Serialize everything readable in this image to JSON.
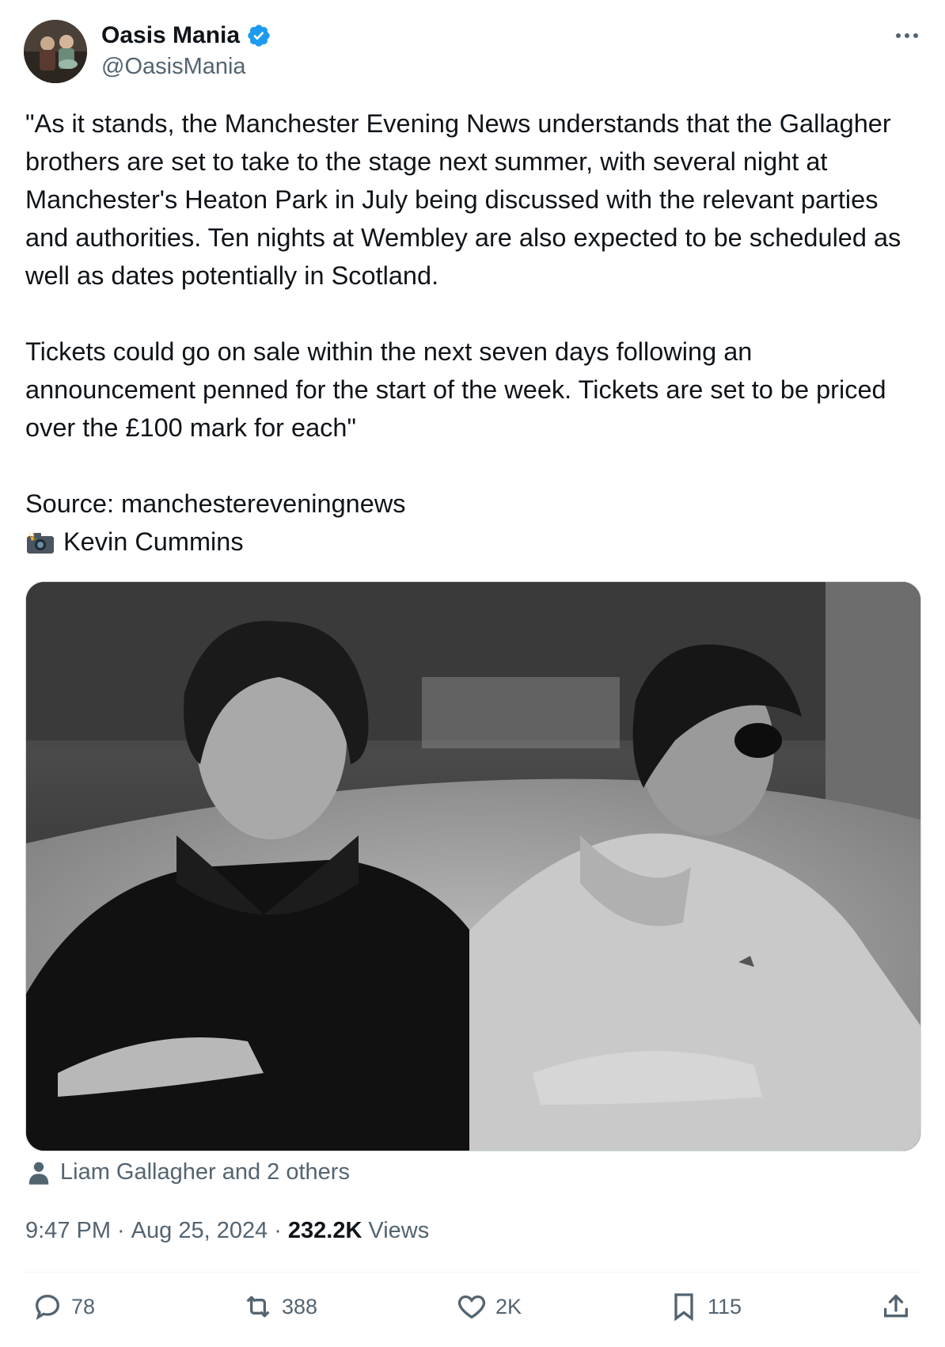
{
  "author": {
    "name": "Oasis Mania",
    "handle": "@OasisMania",
    "verified": true,
    "verified_color": "#1d9bf0"
  },
  "tweet": {
    "paragraph_1": "\"As it stands, the Manchester Evening News understands that the Gallagher brothers are set to take to the stage next summer, with several night at Manchester's Heaton Park in July being discussed with the relevant parties and authorities. Ten nights at Wembley are also expected to be scheduled as well as dates potentially in Scotland.",
    "paragraph_2": "Tickets could go on sale within the next seven days following an announcement penned for the start of the week. Tickets are set to be priced over the £100 mark for each\"",
    "source": "Source: manchestereveningnews",
    "photo_credit": "Kevin Cummins"
  },
  "media": {
    "tagged": "Liam Gallagher and 2 others"
  },
  "meta": {
    "time": "9:47 PM",
    "date": "Aug 25, 2024",
    "separator": "·",
    "views_count": "232.2K",
    "views_label": "Views"
  },
  "actions": {
    "replies": "78",
    "reposts": "388",
    "likes": "2K",
    "bookmarks": "115"
  },
  "colors": {
    "text": "#0f1419",
    "secondary": "#536471",
    "divider": "#eff3f4"
  }
}
